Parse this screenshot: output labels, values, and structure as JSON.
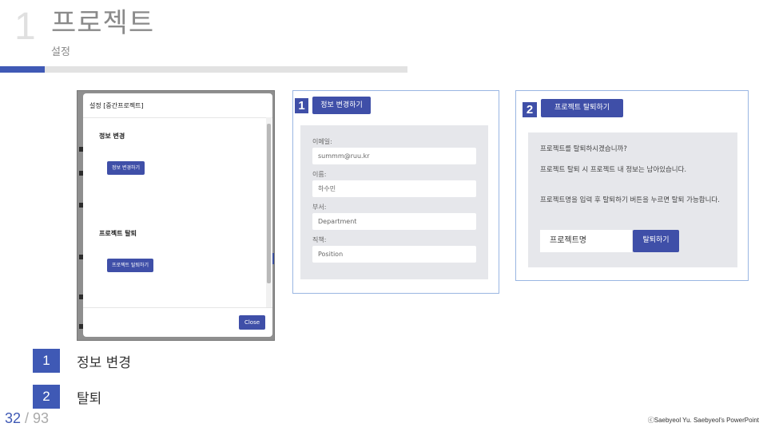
{
  "header": {
    "section_number": "1",
    "title": "프로젝트",
    "subtitle": "설정"
  },
  "modal": {
    "title": "설정 [중간프로젝트]",
    "section_info": "정보 변경",
    "btn_info": "정보 변경하기",
    "section_withdraw": "프로젝트 탈퇴",
    "btn_withdraw": "프로젝트 탈퇴하기",
    "btn_close": "Close"
  },
  "info_change": {
    "badge": "1",
    "header_button": "정보 변경하기",
    "fields": [
      {
        "label": "이메일:",
        "value": "summm@ruu.kr"
      },
      {
        "label": "이름:",
        "value": "하수민"
      },
      {
        "label": "부서:",
        "value": "Department"
      },
      {
        "label": "직책:",
        "value": "Position"
      }
    ]
  },
  "withdraw": {
    "badge": "2",
    "header_button": "프로젝트 탈퇴하기",
    "question": "프로젝트를 탈퇴하시겠습니까?",
    "warning": "프로젝트 탈퇴 시 프로젝트 내 정보는 남아있습니다.",
    "instruction": "프로젝트명을 입력 후 탈퇴하기 버튼을 누르면 탈퇴 가능합니다.",
    "input_value": "프로젝트명",
    "button": "탈퇴하기"
  },
  "legend": [
    {
      "number": "1",
      "text": "정보 변경"
    },
    {
      "number": "2",
      "text": "탈퇴"
    }
  ],
  "footer": {
    "current_page": "32",
    "separator": " / ",
    "total_pages": "93",
    "copyright": "ⓒSaebyeol Yu. Saebyeol's PowerPoint"
  },
  "colors": {
    "accent": "#3f59b5",
    "button": "#3f4fa8",
    "panel": "#e6e7eb",
    "frame_border": "#9ab6e2"
  }
}
